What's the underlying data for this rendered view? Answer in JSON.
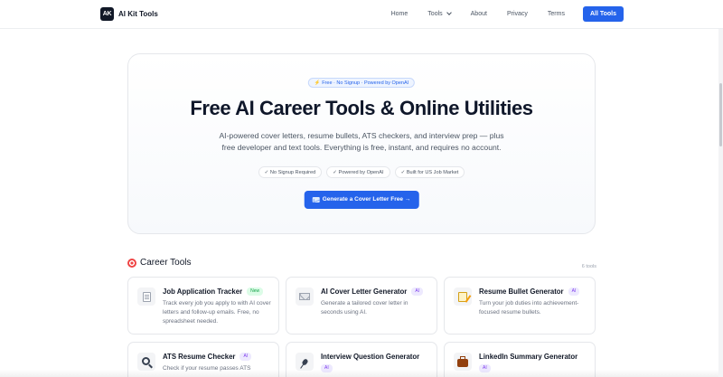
{
  "header": {
    "logo_mark": "AK",
    "brand": "AI Kit Tools",
    "nav": {
      "home": "Home",
      "tools": "Tools",
      "about": "About",
      "privacy": "Privacy",
      "terms": "Terms",
      "all_tools": "All Tools"
    }
  },
  "hero": {
    "badge": "⚡ Free · No Signup · Powered by OpenAI",
    "title": "Free AI Career Tools & Online Utilities",
    "description": "AI-powered cover letters, resume bullets, ATS checkers, and interview prep — plus free developer and text tools. Everything is free, instant, and requires no account.",
    "chips": [
      "✓ No Signup Required",
      "✓ Powered by OpenAI",
      "✓ Built for US Job Market"
    ],
    "cta": "Generate a Cover Letter Free →"
  },
  "section": {
    "title": "Career Tools",
    "count": "6 tools"
  },
  "cards": [
    {
      "title": "Job Application Tracker",
      "tag": "New",
      "icon": "clipboard-icon",
      "desc": "Track every job you apply to with AI cover letters and follow-up emails. Free, no spreadsheet needed."
    },
    {
      "title": "AI Cover Letter Generator",
      "tag": "AI",
      "icon": "envelope-icon",
      "desc": "Generate a tailored cover letter in seconds using AI."
    },
    {
      "title": "Resume Bullet Generator",
      "tag": "AI",
      "icon": "memo-icon",
      "desc": "Turn your job duties into achievement-focused resume bullets."
    },
    {
      "title": "ATS Resume Checker",
      "tag": "AI",
      "icon": "magnifier-icon",
      "desc": "Check if your resume passes ATS"
    },
    {
      "title": "Interview Question Generator",
      "tag": "AI",
      "icon": "microphone-icon",
      "desc": ""
    },
    {
      "title": "LinkedIn Summary Generator",
      "tag": "AI",
      "icon": "briefcase-icon",
      "desc": ""
    }
  ],
  "colors": {
    "accent": "#2563eb",
    "new_tag": "#16a34a",
    "ai_tag": "#7c3aed"
  }
}
